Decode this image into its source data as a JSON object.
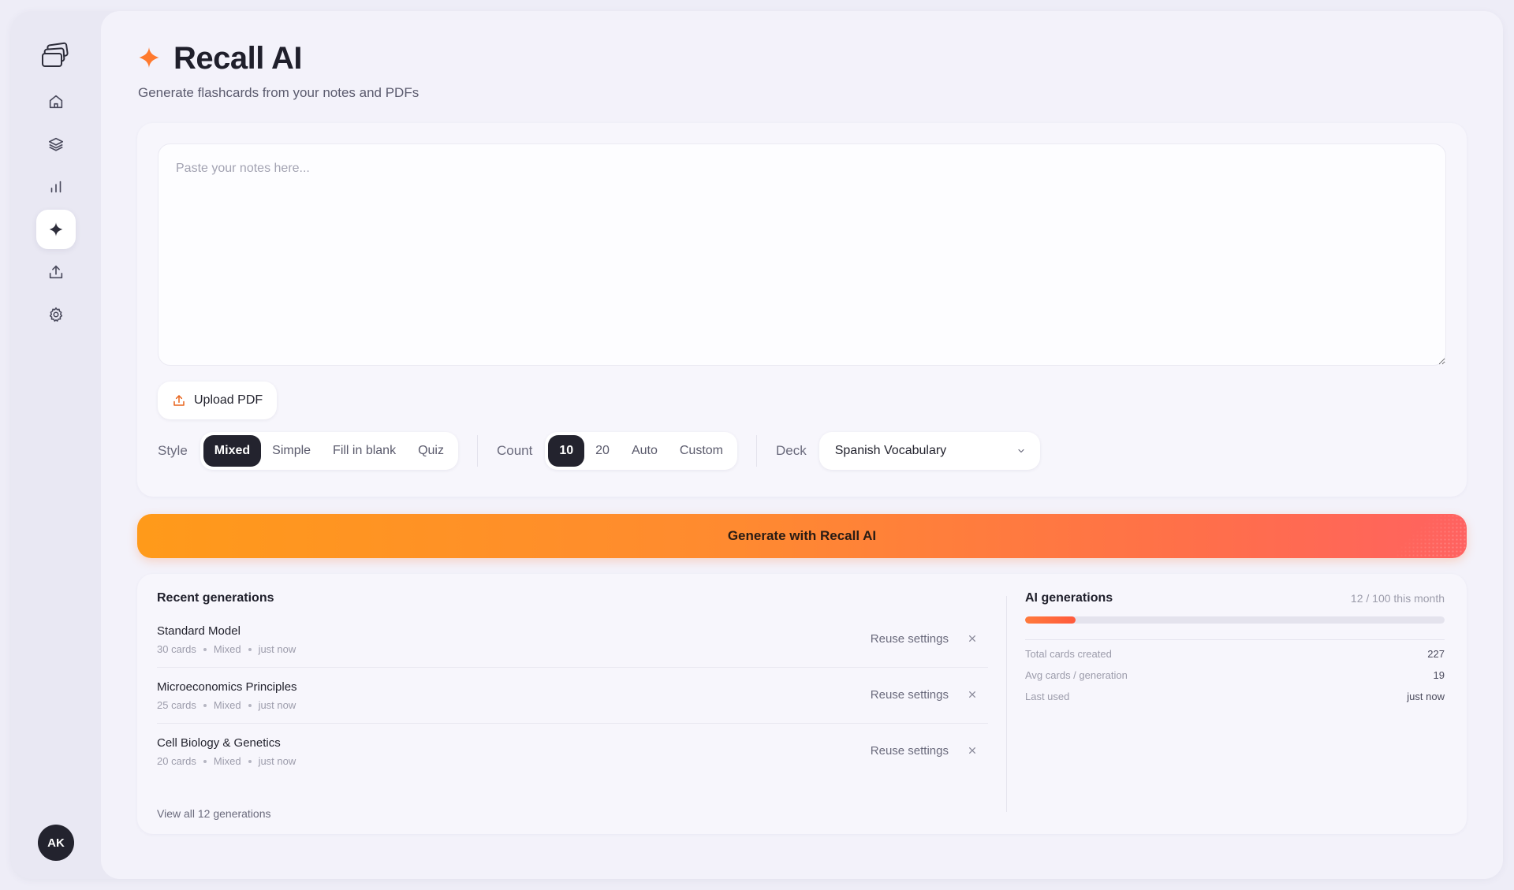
{
  "app": {
    "title": "Recall AI",
    "subtitle": "Generate flashcards from your notes and PDFs",
    "accent": "#ff7a2e"
  },
  "sidebar": {
    "items": [
      {
        "icon": "home-icon",
        "active": false
      },
      {
        "icon": "layers-icon",
        "active": false
      },
      {
        "icon": "bar-chart-icon",
        "active": false
      },
      {
        "icon": "sparkle-icon",
        "active": true
      },
      {
        "icon": "upload-icon",
        "active": false
      },
      {
        "icon": "gear-icon",
        "active": false
      }
    ],
    "user_initials": "AK"
  },
  "composer": {
    "notes_placeholder": "Paste your notes here...",
    "notes_value": "",
    "upload_label": "Upload PDF",
    "style_label": "Style",
    "style_options": [
      "Mixed",
      "Simple",
      "Fill in blank",
      "Quiz"
    ],
    "style_selected": "Mixed",
    "count_label": "Count",
    "count_options": [
      "10",
      "20",
      "Auto",
      "Custom"
    ],
    "count_selected": "10",
    "deck_label": "Deck",
    "deck_selected": "Spanish Vocabulary"
  },
  "generate_label": "Generate with Recall AI",
  "recent": {
    "title": "Recent generations",
    "items": [
      {
        "name": "Standard Model",
        "cards": "30 cards",
        "style": "Mixed",
        "when": "just now",
        "action": "Reuse settings"
      },
      {
        "name": "Microeconomics Principles",
        "cards": "25 cards",
        "style": "Mixed",
        "when": "just now",
        "action": "Reuse settings"
      },
      {
        "name": "Cell Biology & Genetics",
        "cards": "20 cards",
        "style": "Mixed",
        "when": "just now",
        "action": "Reuse settings"
      }
    ],
    "view_all": "View all 12 generations"
  },
  "stats": {
    "title": "AI generations",
    "usage_text": "12 / 100 this month",
    "usage_fraction": 0.12,
    "rows": [
      {
        "label": "Total cards created",
        "value": "227"
      },
      {
        "label": "Avg cards / generation",
        "value": "19"
      },
      {
        "label": "Last used",
        "value": "just now"
      }
    ]
  }
}
